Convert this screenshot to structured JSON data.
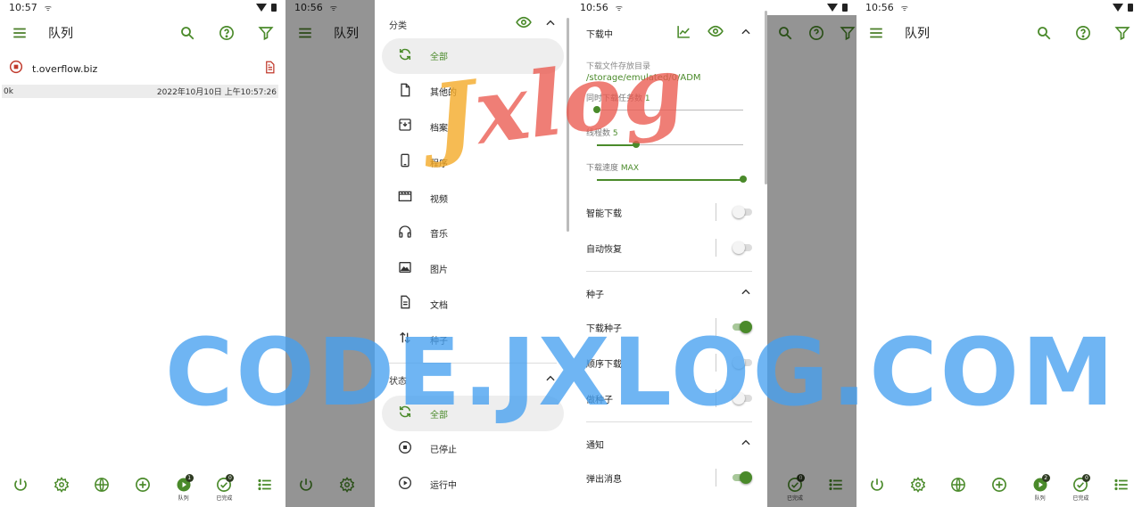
{
  "colors": {
    "accent": "#4a8a2a",
    "drawer_active_bg": "#eeeeee",
    "progress_bg": "#ececec",
    "watermark_blue": "#46a0f0",
    "watermark_red": "#eb5a50"
  },
  "panel1": {
    "status": {
      "time": "10:57",
      "extra": "ᯤ"
    },
    "appbar": {
      "title": "队列"
    },
    "queue": [
      {
        "name": "t.overflow.biz",
        "size": "0k",
        "date": "2022年10月10日 上午10:57:26",
        "status_icon": "stop-circle-icon",
        "file_icon": "document-icon"
      }
    ]
  },
  "panel2": {
    "status": {
      "time": "10:56",
      "extra": "ᯤ"
    },
    "appbar": {
      "title": "队列"
    }
  },
  "drawer": {
    "category_header": "分类",
    "categories": [
      {
        "label": "全部",
        "icon": "refresh-icon"
      },
      {
        "label": "其他的",
        "icon": "file-icon"
      },
      {
        "label": "档案",
        "icon": "archive-icon"
      },
      {
        "label": "程序",
        "icon": "phone-icon"
      },
      {
        "label": "视频",
        "icon": "movie-icon"
      },
      {
        "label": "音乐",
        "icon": "headphones-icon"
      },
      {
        "label": "图片",
        "icon": "image-icon"
      },
      {
        "label": "文档",
        "icon": "document-icon"
      },
      {
        "label": "种子",
        "icon": "swap-icon"
      }
    ],
    "state_header": "状态",
    "states": [
      {
        "label": "全部",
        "icon": "refresh-icon"
      },
      {
        "label": "已停止",
        "icon": "stop-circle-icon"
      },
      {
        "label": "运行中",
        "icon": "play-circle-icon"
      }
    ]
  },
  "sheet": {
    "status": {
      "time": "10:56",
      "extra": "ᯤ"
    },
    "header": "下载中",
    "dir_label": "下载文件存放目录",
    "dir_value": "/storage/emulated/0/ADM",
    "sliders": [
      {
        "label": "同时下载任务数",
        "value": "1",
        "fraction": 0
      },
      {
        "label": "线程数",
        "value": "5",
        "fraction": 0.27
      },
      {
        "label": "下载速度",
        "value": "MAX",
        "fraction": 1
      }
    ],
    "toggles": [
      {
        "label": "智能下载",
        "on": false
      },
      {
        "label": "自动恢复",
        "on": false
      }
    ],
    "torrent_header": "种子",
    "torrent_toggles": [
      {
        "label": "下载种子",
        "on": true
      },
      {
        "label": "顺序下载",
        "on": false
      },
      {
        "label": "做种子",
        "on": false
      }
    ],
    "notify_header": "通知",
    "notify_toggles": [
      {
        "label": "弹出消息",
        "on": true
      }
    ]
  },
  "panel4": {
    "status": {
      "time": "10:56",
      "extra": "ᯤ"
    },
    "appbar": {
      "title": "队列"
    }
  },
  "bottom_nav": {
    "queue_label": "队列",
    "queue_badge": "1",
    "done_label": "已完成",
    "done_badge": "0"
  },
  "panel4_nav": {
    "queue_badge": "2",
    "done_badge": "0"
  },
  "watermark": {
    "code": "CODE.JXLOG.COM",
    "logo_j": "J",
    "logo_rest": "xlog"
  }
}
